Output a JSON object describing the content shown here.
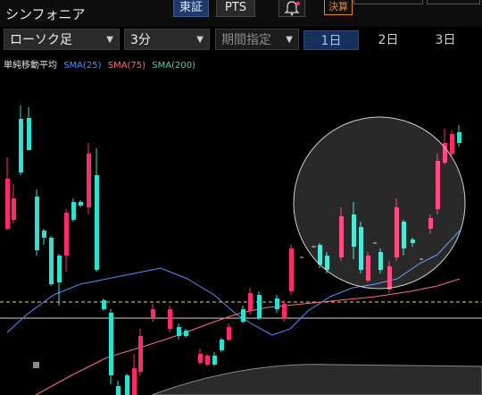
{
  "app": {
    "title": "シンフォニア"
  },
  "market_tabs": {
    "active": "東証",
    "other": "PTS"
  },
  "badge": {
    "kessan": "決算"
  },
  "toolbar": {
    "chart_type": "ローソク足",
    "interval": "3分",
    "period": "期間指定",
    "day_tabs": [
      "1日",
      "2日",
      "3日"
    ],
    "active_day": "1日"
  },
  "legend": {
    "label": "単純移動平均",
    "sma25": "SMA(25)",
    "sma75": "SMA(75)",
    "sma200": "SMA(200)"
  },
  "colors": {
    "up": "#ff2a6a",
    "down": "#2ee0d0",
    "sma25": "#4f8fff",
    "sma75": "#ff6b8a",
    "sma200": "#3ddc97",
    "dashed": "#e8d84a"
  },
  "icons": {
    "bell": "bell-icon"
  }
}
